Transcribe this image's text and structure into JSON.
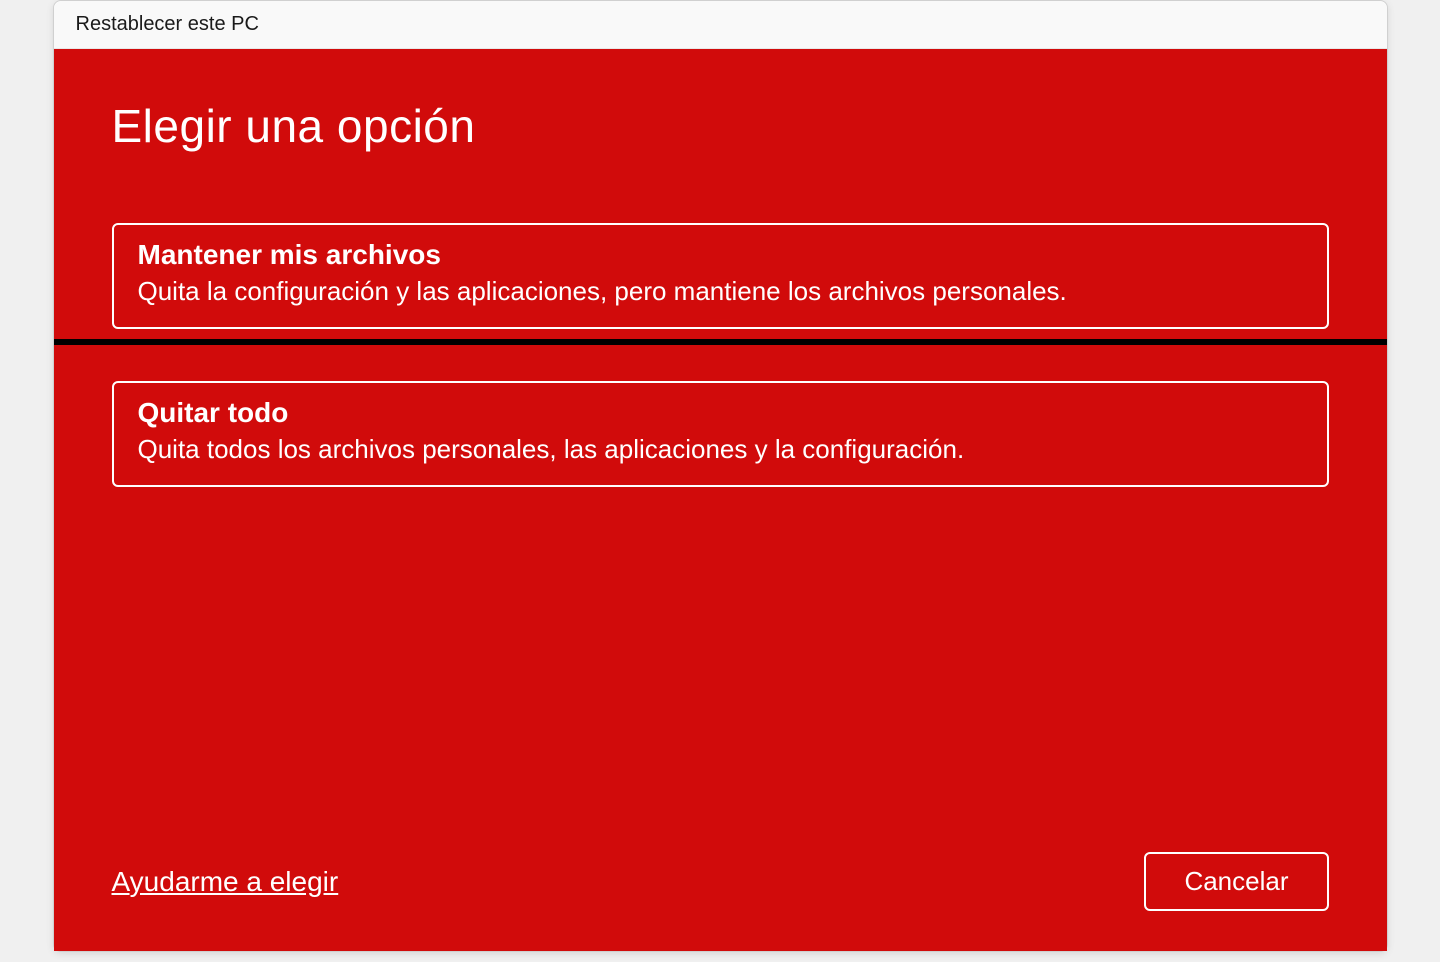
{
  "titlebar": {
    "title": "Restablecer este PC"
  },
  "dialog": {
    "heading": "Elegir una opción",
    "options": [
      {
        "title": "Mantener mis archivos",
        "description": "Quita la configuración y las aplicaciones, pero mantiene los archivos personales."
      },
      {
        "title": "Quitar todo",
        "description": "Quita todos los archivos personales, las aplicaciones y la configuración."
      }
    ],
    "help_link": "Ayudarme a elegir",
    "cancel_label": "Cancelar"
  }
}
